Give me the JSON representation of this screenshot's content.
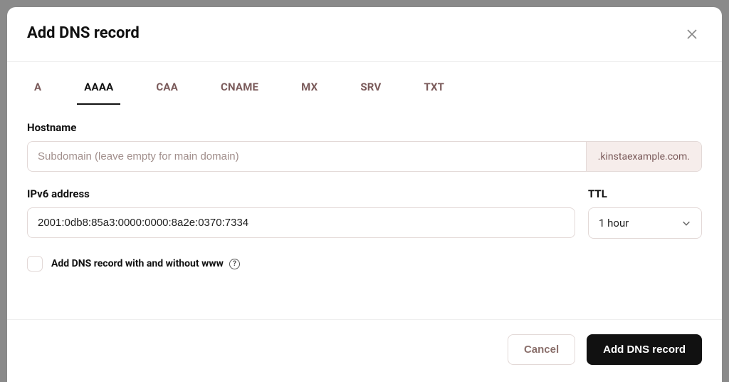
{
  "modal": {
    "title": "Add DNS record"
  },
  "tabs": [
    {
      "label": "A",
      "active": false
    },
    {
      "label": "AAAA",
      "active": true
    },
    {
      "label": "CAA",
      "active": false
    },
    {
      "label": "CNAME",
      "active": false
    },
    {
      "label": "MX",
      "active": false
    },
    {
      "label": "SRV",
      "active": false
    },
    {
      "label": "TXT",
      "active": false
    }
  ],
  "form": {
    "hostname_label": "Hostname",
    "hostname_placeholder": "Subdomain (leave empty for main domain)",
    "hostname_value": "",
    "domain_suffix": ".kinstaexample.com.",
    "ipv6_label": "IPv6 address",
    "ipv6_value": "2001:0db8:85a3:0000:0000:8a2e:0370:7334",
    "ttl_label": "TTL",
    "ttl_value": "1 hour",
    "www_checkbox_label": "Add DNS record with and without www",
    "www_checked": false
  },
  "footer": {
    "cancel_label": "Cancel",
    "submit_label": "Add DNS record"
  }
}
